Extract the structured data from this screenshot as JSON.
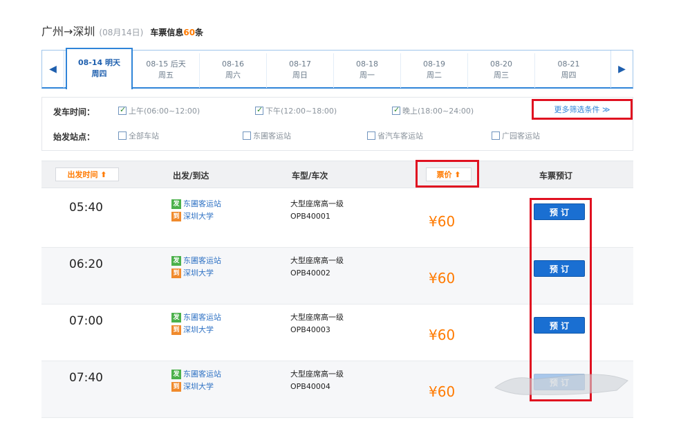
{
  "header": {
    "route": "广州→深圳",
    "date": "(08月14日)",
    "info_prefix": "车票信息",
    "count": "60",
    "info_suffix": "条"
  },
  "date_tabs": [
    {
      "line1": "08-14 明天",
      "line2": "周四",
      "active": true
    },
    {
      "line1": "08-15 后天",
      "line2": "周五",
      "active": false
    },
    {
      "line1": "08-16",
      "line2": "周六",
      "active": false
    },
    {
      "line1": "08-17",
      "line2": "周日",
      "active": false
    },
    {
      "line1": "08-18",
      "line2": "周一",
      "active": false
    },
    {
      "line1": "08-19",
      "line2": "周二",
      "active": false
    },
    {
      "line1": "08-20",
      "line2": "周三",
      "active": false
    },
    {
      "line1": "08-21",
      "line2": "周四",
      "active": false
    }
  ],
  "filters": {
    "depart_time_label": "发车时间：",
    "depart_options": [
      {
        "label": "上午(06:00~12:00)",
        "checked": true
      },
      {
        "label": "下午(12:00~18:00)",
        "checked": true
      },
      {
        "label": "晚上(18:00~24:00)",
        "checked": true
      }
    ],
    "more_filter": "更多筛选条件 ≫",
    "station_label": "始发站点：",
    "station_options": [
      {
        "label": "全部车站",
        "checked": false
      },
      {
        "label": "东圃客运站",
        "checked": false
      },
      {
        "label": "省汽车客运站",
        "checked": false
      },
      {
        "label": "广园客运站",
        "checked": false
      }
    ]
  },
  "table_header": {
    "depart_time_sort": "出发时间 ⬆",
    "depart_arrive": "出发/到达",
    "vehicle": "车型/车次",
    "price_sort": "票价 ⬆",
    "booking": "车票预订"
  },
  "rows": [
    {
      "time": "05:40",
      "from": "东圃客运站",
      "to": "深圳大学",
      "vehicle_type": "大型座席高一级",
      "trip_no": "OPB40001",
      "price": "¥60",
      "book": "预 订"
    },
    {
      "time": "06:20",
      "from": "东圃客运站",
      "to": "深圳大学",
      "vehicle_type": "大型座席高一级",
      "trip_no": "OPB40002",
      "price": "¥60",
      "book": "预 订"
    },
    {
      "time": "07:00",
      "from": "东圃客运站",
      "to": "深圳大学",
      "vehicle_type": "大型座席高一级",
      "trip_no": "OPB40003",
      "price": "¥60",
      "book": "预 订"
    },
    {
      "time": "07:40",
      "from": "东圃客运站",
      "to": "深圳大学",
      "vehicle_type": "大型座席高一级",
      "trip_no": "OPB40004",
      "price": "¥60",
      "book": "预 订"
    }
  ],
  "badges": {
    "depart": "发",
    "arrive": "到"
  },
  "icons": {
    "prev": "chevron-left-icon",
    "next": "chevron-right-icon"
  },
  "colors": {
    "accent": "#2f84d8",
    "price": "#ff7a00",
    "highlight": "#e01020",
    "button": "#1a6fd2"
  }
}
